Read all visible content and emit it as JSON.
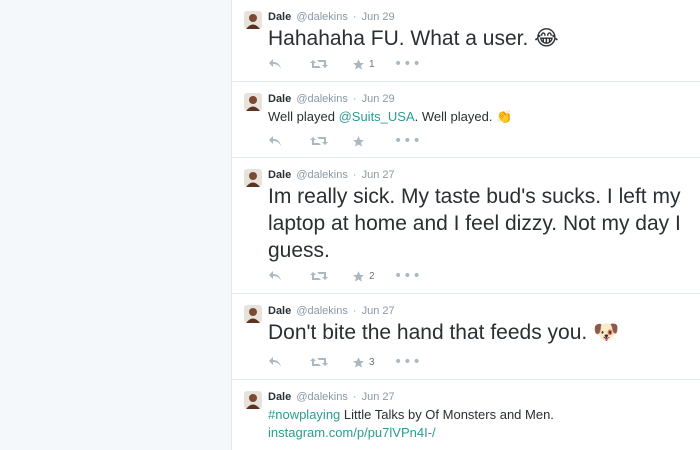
{
  "colors": {
    "background": "#f5f8fa",
    "card": "#ffffff",
    "text": "#292f33",
    "muted": "#8899a6",
    "link": "#2a9d8f",
    "icon": "#aab8c2"
  },
  "tweets": [
    {
      "name": "Dale",
      "handle": "@dalekins",
      "separator": "·",
      "time": "Jun 29",
      "text": "Hahahaha FU. What a user.",
      "emoji": "😂",
      "favorites": "1"
    },
    {
      "name": "Dale",
      "handle": "@dalekins",
      "separator": "·",
      "time": "Jun 29",
      "text_prefix": "Well played ",
      "mention": "@Suits_USA",
      "text_suffix": ". Well played.",
      "emoji": "👏",
      "favorites": ""
    },
    {
      "name": "Dale",
      "handle": "@dalekins",
      "separator": "·",
      "time": "Jun 27",
      "text": "Im really sick. My taste bud's sucks. I left my laptop at home and I feel dizzy. Not my day I guess.",
      "favorites": "2"
    },
    {
      "name": "Dale",
      "handle": "@dalekins",
      "separator": "·",
      "time": "Jun 27",
      "text": "Don't bite the hand that feeds you.",
      "emoji": "🐶",
      "favorites": "3"
    },
    {
      "name": "Dale",
      "handle": "@dalekins",
      "separator": "·",
      "time": "Jun 27",
      "hashtag": "#nowplaying",
      "text": " Little Talks by Of Monsters and Men.",
      "url": "instagram.com/p/pu7lVPn4I-/"
    }
  ],
  "icons": {
    "reply": "reply-icon",
    "retweet": "retweet-icon",
    "favorite": "star-icon",
    "more": "more-icon"
  },
  "more_glyph": "•••"
}
